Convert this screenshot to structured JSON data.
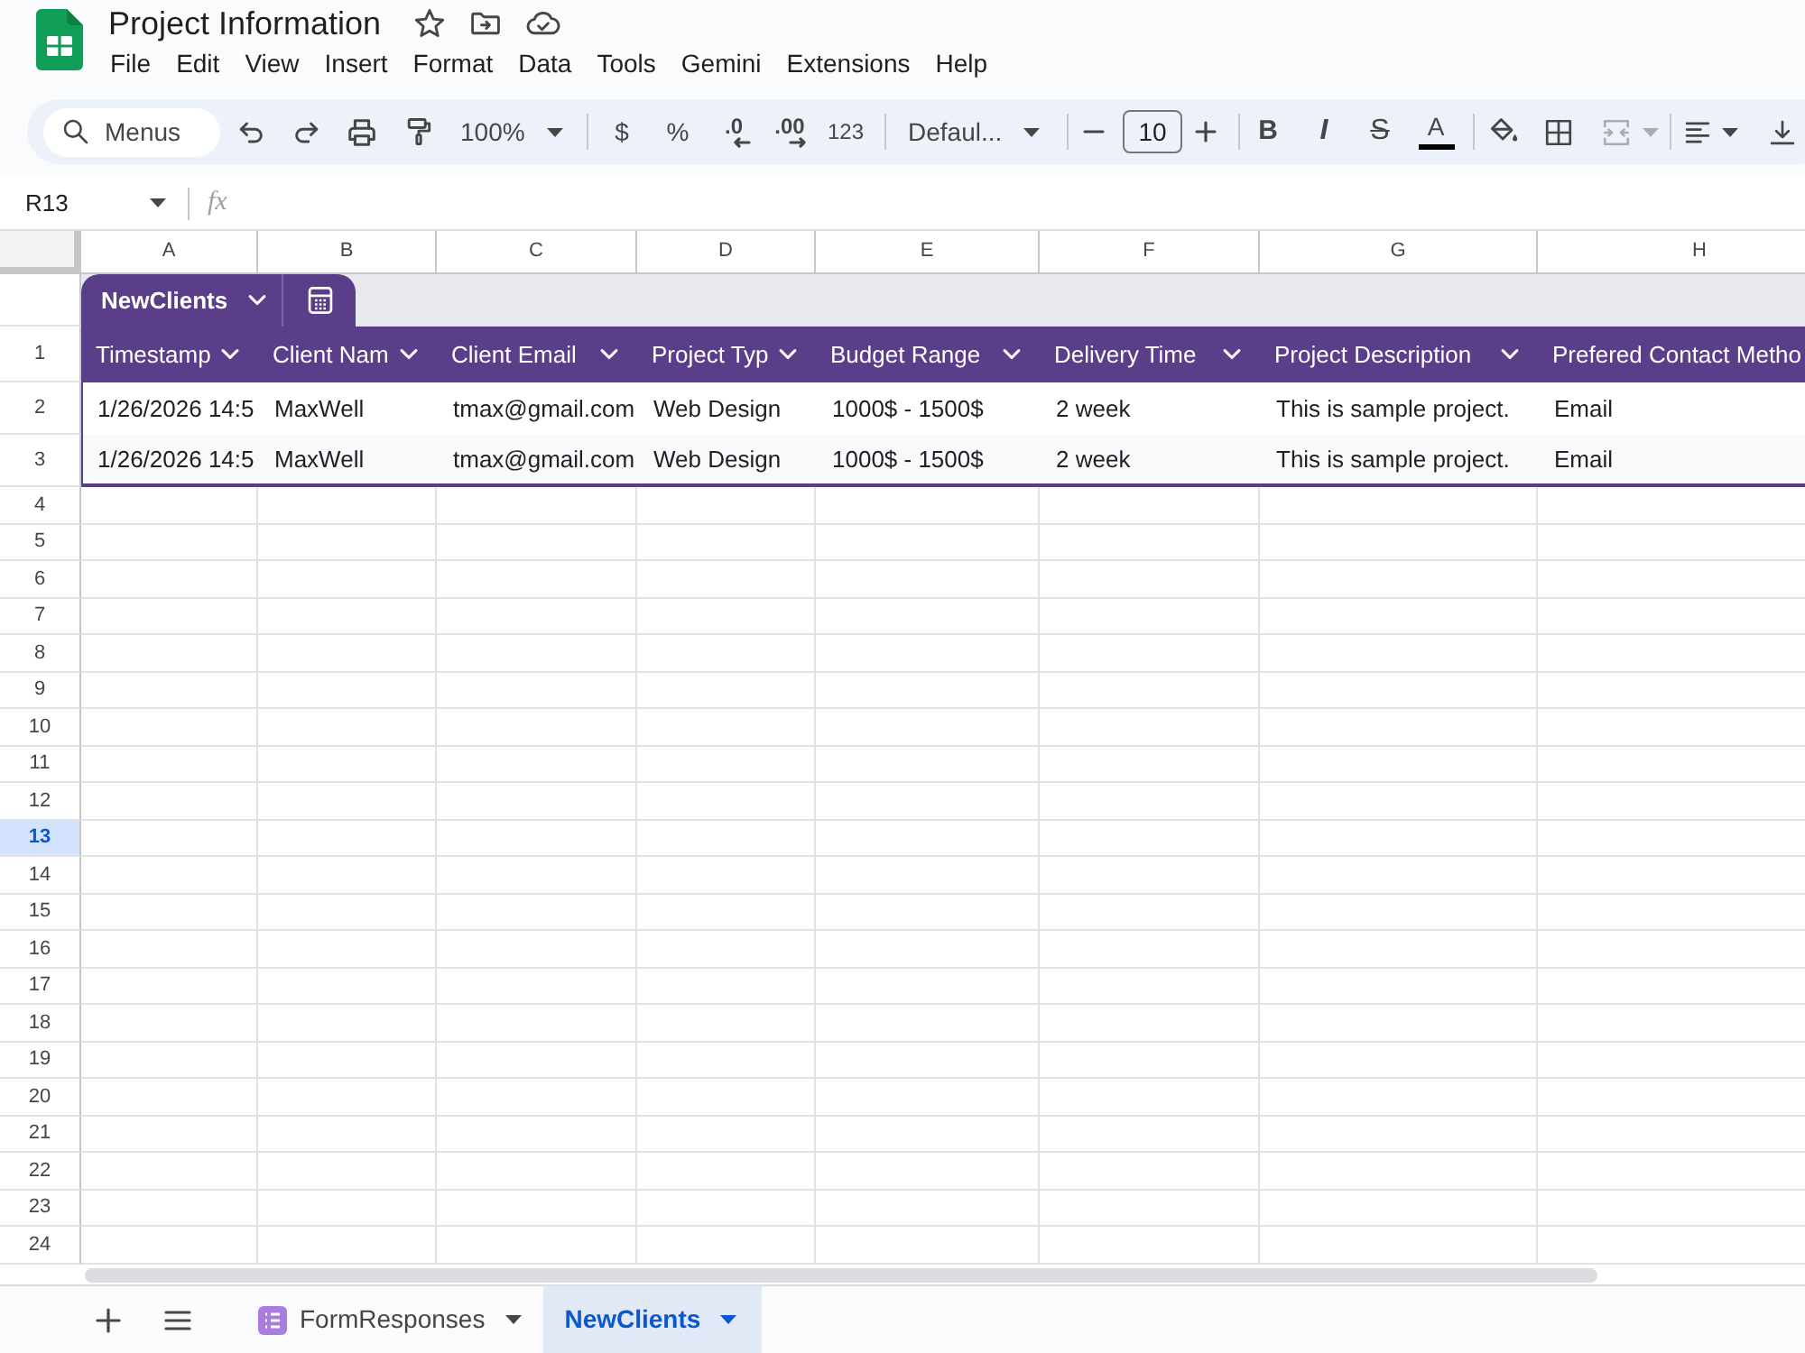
{
  "app": {
    "title": "Project Information",
    "menu": [
      "File",
      "Edit",
      "View",
      "Insert",
      "Format",
      "Data",
      "Tools",
      "Gemini",
      "Extensions",
      "Help"
    ]
  },
  "toolbar": {
    "search": {
      "placeholder": "Menus"
    },
    "zoom": "100%",
    "currency": "$",
    "percent": "%",
    "decrease_decimal": ".0",
    "increase_decimal": ".00",
    "number_format": "123",
    "font": "Defaul...",
    "font_size": "10",
    "bold": "B",
    "italic": "I",
    "strikethrough": "S",
    "text_color": "A",
    "merge": {
      "disabled": true
    }
  },
  "formula_bar": {
    "name_box": "R13",
    "fx": "fx"
  },
  "columns": [
    "A",
    "B",
    "C",
    "D",
    "E",
    "F",
    "G",
    "H"
  ],
  "table": {
    "name": "NewClients",
    "headers": [
      "Timestamp",
      "Client Nam",
      "Client Email",
      "Project Typ",
      "Budget Range",
      "Delivery Time",
      "Project Description",
      "Prefered Contact Metho"
    ],
    "rows": [
      [
        "1/26/2026 14:5",
        "MaxWell",
        "tmax@gmail.com",
        "Web Design",
        "1000$ - 1500$",
        "2 week",
        "This is sample project.",
        "Email"
      ],
      [
        "1/26/2026 14:5",
        "MaxWell",
        "tmax@gmail.com",
        "Web Design",
        "1000$ - 1500$",
        "2 week",
        "This is sample project.",
        "Email"
      ]
    ]
  },
  "row_numbers": [
    {
      "label": "1",
      "selected": false
    },
    {
      "label": "2",
      "selected": false
    },
    {
      "label": "3",
      "selected": false
    },
    {
      "label": "4",
      "selected": false
    },
    {
      "label": "5",
      "selected": false
    },
    {
      "label": "6",
      "selected": false
    },
    {
      "label": "7",
      "selected": false
    },
    {
      "label": "8",
      "selected": false
    },
    {
      "label": "9",
      "selected": false
    },
    {
      "label": "10",
      "selected": false
    },
    {
      "label": "11",
      "selected": false
    },
    {
      "label": "12",
      "selected": false
    },
    {
      "label": "13",
      "selected": true
    },
    {
      "label": "14",
      "selected": false
    },
    {
      "label": "15",
      "selected": false
    },
    {
      "label": "16",
      "selected": false
    },
    {
      "label": "17",
      "selected": false
    },
    {
      "label": "18",
      "selected": false
    },
    {
      "label": "19",
      "selected": false
    },
    {
      "label": "20",
      "selected": false
    },
    {
      "label": "21",
      "selected": false
    },
    {
      "label": "22",
      "selected": false
    },
    {
      "label": "23",
      "selected": false
    },
    {
      "label": "24",
      "selected": false
    }
  ],
  "sheet_tabs": [
    {
      "label": "FormResponses",
      "kind": "form",
      "selected": false
    },
    {
      "label": "NewClients",
      "kind": "plain",
      "selected": true
    }
  ]
}
